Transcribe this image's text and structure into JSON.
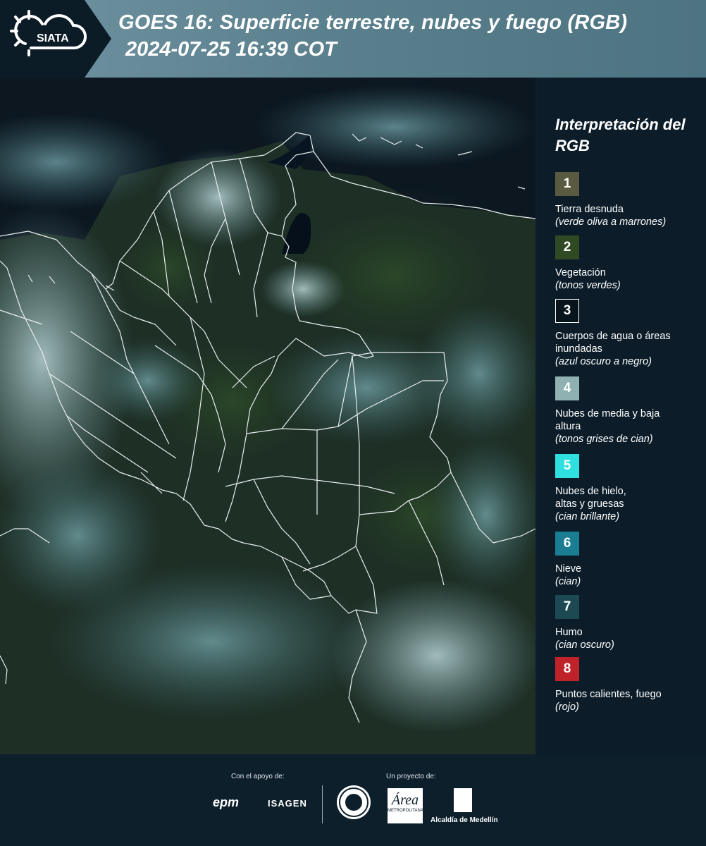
{
  "header": {
    "logo_text": "SIATA",
    "title_line1": "GOES 16: Superficie terrestre, nubes y fuego (RGB)",
    "title_line2": "2024-07-25 16:39 COT"
  },
  "legend": {
    "title": "Interpretación del RGB",
    "items": [
      {
        "number": "1",
        "label": "Tierra desnuda",
        "note": "(verde oliva a marrones)",
        "color": "#5a5a40"
      },
      {
        "number": "2",
        "label": "Vegetación",
        "note": "(tonos verdes)",
        "color": "#2f4a22"
      },
      {
        "number": "3",
        "label": "Cuerpos de agua o áreas inundadas",
        "note": "(azul oscuro a negro)",
        "color": "#08141b"
      },
      {
        "number": "4",
        "label": "Nubes de media y baja altura",
        "note": "(tonos grises de cian)",
        "color": "#8fb1b1"
      },
      {
        "number": "5",
        "label": "Nubes de hielo, altas y gruesas",
        "note": "(cian brillante)",
        "color": "#2ee0e0"
      },
      {
        "number": "6",
        "label": "Nieve",
        "note": "(cian)",
        "color": "#1b7d93"
      },
      {
        "number": "7",
        "label": "Humo",
        "note": "(cian oscuro)",
        "color": "#1d4a52"
      },
      {
        "number": "8",
        "label": "Puntos calientes, fuego",
        "note": "(rojo)",
        "color": "#c0222a"
      }
    ]
  },
  "footer": {
    "support_label": "Con el apoyo de:",
    "project_label": "Un proyecto de:",
    "sponsors": [
      "epm",
      "ISAGEN"
    ],
    "area_label": "Área",
    "area_sub": "METROPOLITANA",
    "alcaldia": "Alcaldía de Medellín"
  }
}
